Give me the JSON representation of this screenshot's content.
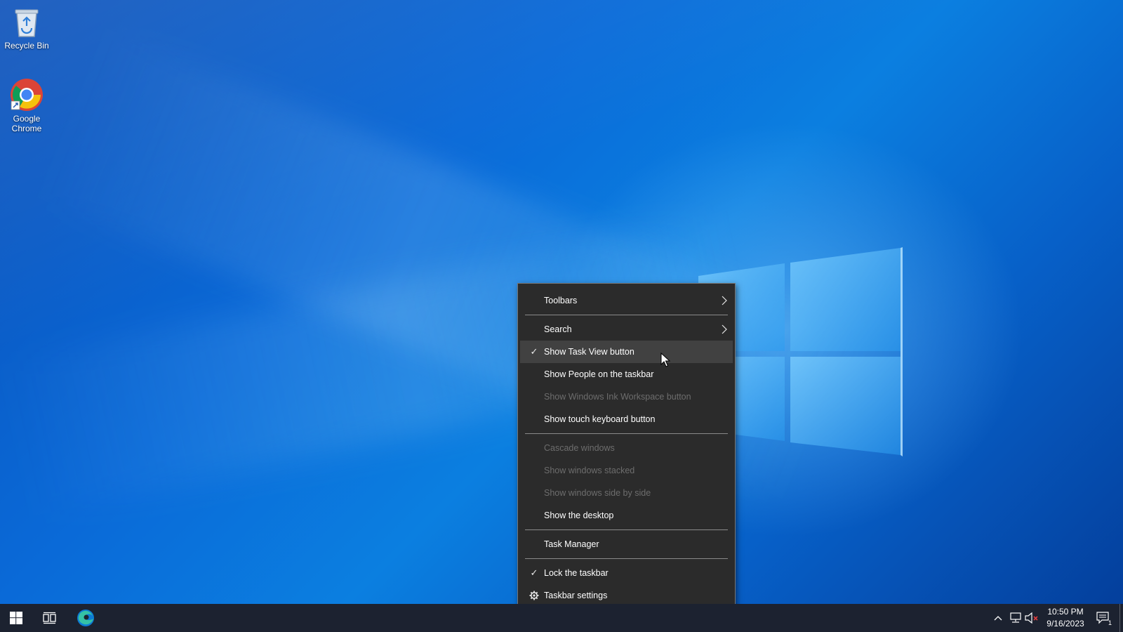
{
  "desktop": {
    "icons": [
      {
        "label": "Recycle Bin",
        "icon": "recycle-bin-icon"
      },
      {
        "label": "Google Chrome",
        "icon": "chrome-icon"
      }
    ]
  },
  "context_menu": {
    "items": [
      {
        "label": "Toolbars",
        "submenu": true
      },
      {
        "label": "Search",
        "submenu": true
      },
      {
        "label": "Show Task View button",
        "checked": true
      },
      {
        "label": "Show People on the taskbar"
      },
      {
        "label": "Show Windows Ink Workspace button",
        "disabled": true
      },
      {
        "label": "Show touch keyboard button"
      },
      {
        "label": "Cascade windows",
        "disabled": true
      },
      {
        "label": "Show windows stacked",
        "disabled": true
      },
      {
        "label": "Show windows side by side",
        "disabled": true
      },
      {
        "label": "Show the desktop"
      },
      {
        "label": "Task Manager"
      },
      {
        "label": "Lock the taskbar",
        "checked": true
      },
      {
        "label": "Taskbar settings",
        "icon": "gear-icon"
      }
    ]
  },
  "taskbar": {
    "clock_time": "10:50 PM",
    "clock_date": "9/16/2023",
    "notification_count": "1",
    "pinned": [
      "windows-start-icon",
      "task-view-icon",
      "edge-icon"
    ],
    "tray": [
      "chevron-up-icon",
      "network-icon",
      "volume-muted-icon"
    ]
  },
  "colors": {
    "accent": "#0a6ad8",
    "menu_bg": "#2b2b2b",
    "taskbar_bg": "#1c2230"
  }
}
